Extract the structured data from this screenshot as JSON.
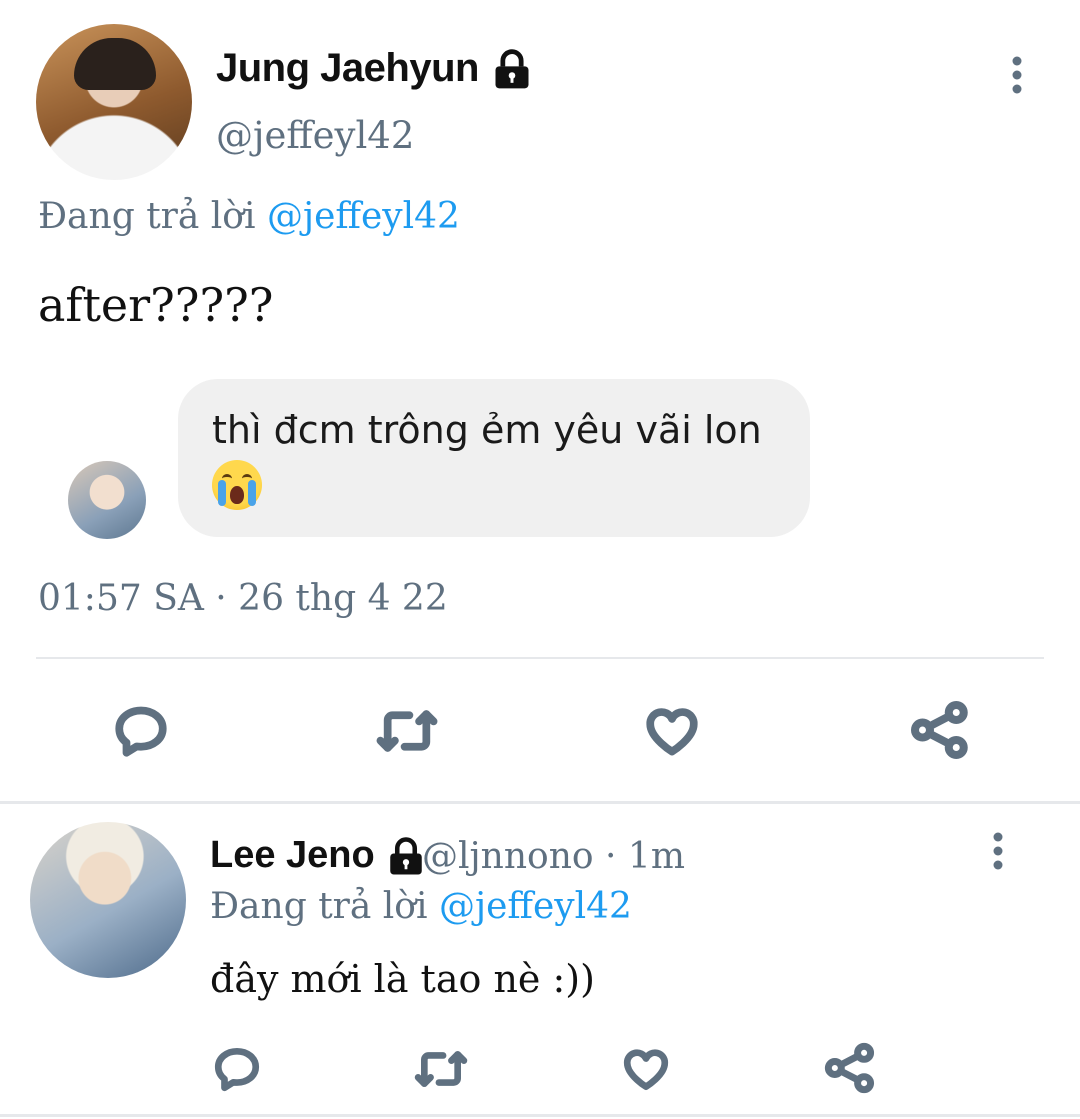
{
  "main_tweet": {
    "author_name": "Jung Jaehyun",
    "author_handle": "@jeffeyl42",
    "reply_prefix": "Đang trả lời",
    "reply_mention": "@jeffeyl42",
    "text": "after?????",
    "quoted_bubble": {
      "text": "thì đcm trông ẻm yêu vãi lon",
      "emoji": "loudly-crying-face"
    },
    "timestamp": "01:57 SA · 26 thg 4 22",
    "actions": [
      "reply-icon",
      "retweet-icon",
      "like-icon",
      "share-icon"
    ]
  },
  "reply_tweet": {
    "author_name": "Lee Jeno",
    "author_handle": "@ljnnono · 1m",
    "reply_prefix": "Đang trả lời",
    "reply_mention": "@jeffeyl42",
    "text": "đây mới là tao nè :))",
    "actions": [
      "reply-icon",
      "retweet-icon",
      "like-icon",
      "share-icon"
    ]
  },
  "colors": {
    "mention": "#1d9bf0",
    "muted": "#5f7080",
    "bubble": "#f0f0f0",
    "divider": "#e6e8eb"
  }
}
